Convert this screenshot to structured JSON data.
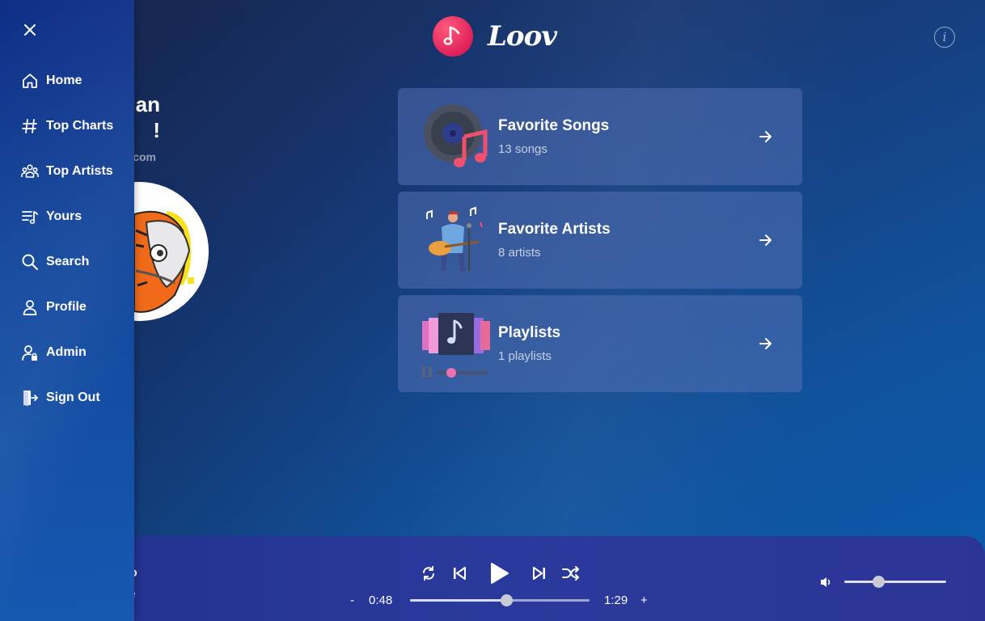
{
  "app": {
    "name": "Loov"
  },
  "header": {
    "info_icon": "info-icon",
    "info_glyph": "i"
  },
  "profile": {
    "greeting_line1": "an",
    "greeting_line2": "!",
    "email_fragment": "com"
  },
  "cards": [
    {
      "title": "Favorite Songs",
      "subtitle": "13 songs",
      "icon": "vinyl-music-illustration"
    },
    {
      "title": "Favorite Artists",
      "subtitle": "8 artists",
      "icon": "guitarist-illustration"
    },
    {
      "title": "Playlists",
      "subtitle": "1 playlists",
      "icon": "playlist-illustration"
    }
  ],
  "sidebar": {
    "close_icon": "close-icon",
    "items": [
      {
        "label": "Home",
        "icon": "home-icon"
      },
      {
        "label": "Top Charts",
        "icon": "hash-icon"
      },
      {
        "label": "Top Artists",
        "icon": "people-icon"
      },
      {
        "label": "Yours",
        "icon": "music-list-icon"
      },
      {
        "label": "Search",
        "icon": "search-icon"
      },
      {
        "label": "Profile",
        "icon": "user-icon"
      },
      {
        "label": "Admin",
        "icon": "admin-user-icon"
      },
      {
        "label": "Sign Out",
        "icon": "sign-out-icon"
      }
    ]
  },
  "player": {
    "track_title": "o",
    "track_artist": "e",
    "current_time": "0:48",
    "total_time": "1:29",
    "minus_label": "-",
    "plus_label": "+",
    "progress_fraction": 0.535,
    "volume_fraction": 0.33
  },
  "colors": {
    "accent": "#e0215a",
    "card_bg": "#5270b2",
    "player_bg": "#2a3a9c"
  }
}
